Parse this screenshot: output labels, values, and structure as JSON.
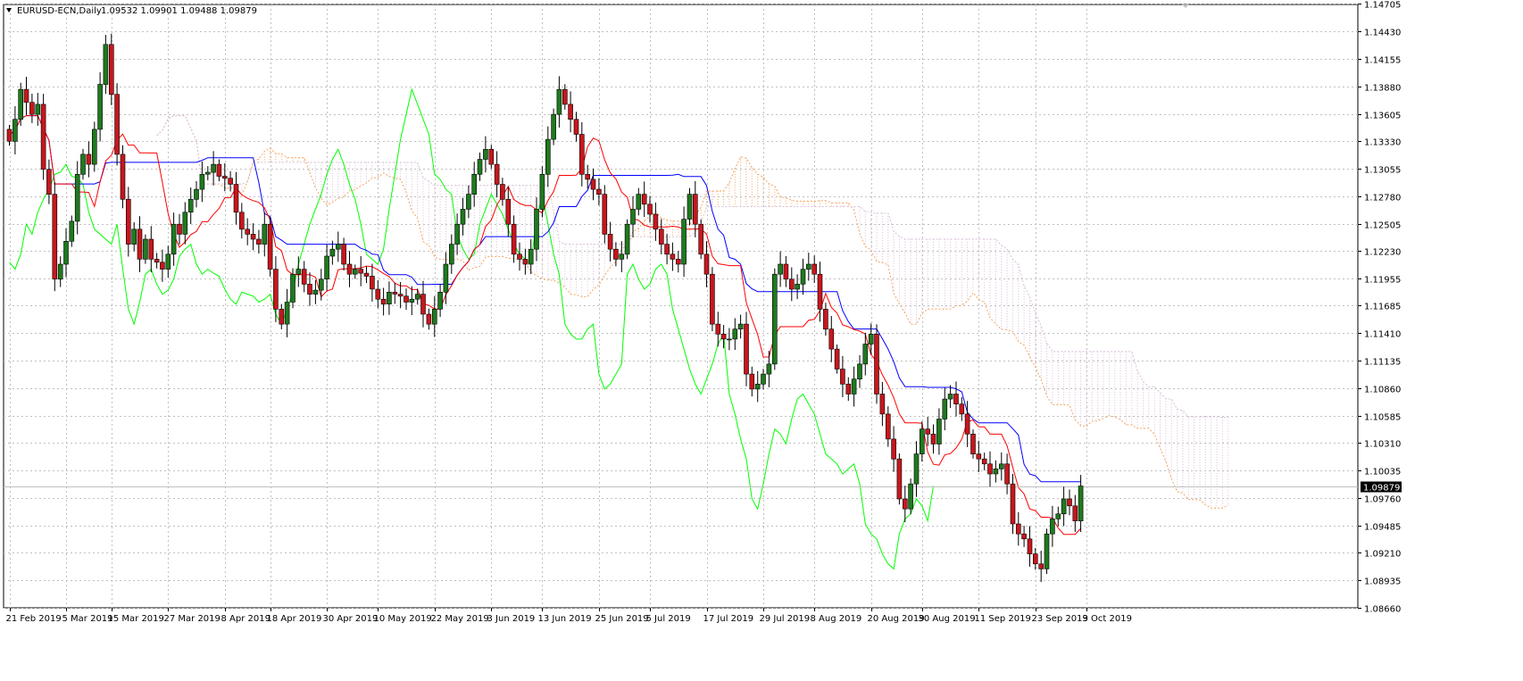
{
  "window": {
    "symbol_title": "EURUSD-ECN,Daily",
    "ohlc_text": "1.09532 1.09901 1.09488 1.09879"
  },
  "colors": {
    "background": "#ffffff",
    "grid": "#c0c0c0",
    "bull_candle": "#1e7a1e",
    "bear_candle": "#c8161d",
    "wick": "#000000",
    "tenkan": "#ff0000",
    "kijun": "#0000ff",
    "chikou": "#00ff00",
    "senkou_a": "#f4a460",
    "senkou_b": "#d8bfd8",
    "current_price_line": "#c0c0c0",
    "price_badge": "#000000"
  },
  "icons": {
    "title_marker": "triangle-down-icon",
    "shift_marker": "triangle-down-icon"
  },
  "chart_data": {
    "type": "candlestick",
    "title": "EURUSD-ECN,Daily",
    "y_range": [
      1.0866,
      1.147
    ],
    "y_ticks": [
      "1.14705",
      "1.14430",
      "1.14155",
      "1.13880",
      "1.13605",
      "1.13330",
      "1.13055",
      "1.12780",
      "1.12505",
      "1.12230",
      "1.11955",
      "1.11685",
      "1.11410",
      "1.11135",
      "1.10860",
      "1.10585",
      "1.10310",
      "1.10035",
      "1.09760",
      "1.09485",
      "1.09210",
      "1.08935",
      "1.08660"
    ],
    "x_ticks": [
      "21 Feb 2019",
      "5 Mar 2019",
      "15 Mar 2019",
      "27 Mar 2019",
      "8 Apr 2019",
      "18 Apr 2019",
      "30 Apr 2019",
      "10 May 2019",
      "22 May 2019",
      "3 Jun 2019",
      "13 Jun 2019",
      "25 Jun 2019",
      "5 Jul 2019",
      "17 Jul 2019",
      "29 Jul 2019",
      "8 Aug 2019",
      "20 Aug 2019",
      "30 Aug 2019",
      "11 Sep 2019",
      "23 Sep 2019",
      "3 Oct 2019"
    ],
    "x_tick_bar_index": [
      0,
      10,
      18,
      28,
      38,
      46,
      56,
      65,
      75,
      85,
      94,
      104,
      113,
      123,
      133,
      142,
      152,
      161,
      171,
      181,
      190
    ],
    "current_price": "1.09879",
    "close_series": [
      1.1333,
      1.1355,
      1.1385,
      1.1372,
      1.136,
      1.137,
      1.1305,
      1.128,
      1.1195,
      1.121,
      1.1233,
      1.1253,
      1.13,
      1.132,
      1.131,
      1.1345,
      1.139,
      1.143,
      1.138,
      1.132,
      1.1275,
      1.123,
      1.1245,
      1.1215,
      1.1235,
      1.1215,
      1.1212,
      1.1205,
      1.122,
      1.125,
      1.124,
      1.1262,
      1.1275,
      1.1285,
      1.13,
      1.1302,
      1.131,
      1.1298,
      1.1296,
      1.129,
      1.1262,
      1.1245,
      1.124,
      1.1235,
      1.123,
      1.125,
      1.1205,
      1.1165,
      1.115,
      1.1172,
      1.12,
      1.1205,
      1.119,
      1.118,
      1.1184,
      1.1195,
      1.1218,
      1.1225,
      1.123,
      1.121,
      1.12,
      1.1205,
      1.1201,
      1.1198,
      1.1185,
      1.1175,
      1.117,
      1.1182,
      1.118,
      1.1178,
      1.1172,
      1.1175,
      1.118,
      1.116,
      1.115,
      1.1165,
      1.1182,
      1.121,
      1.123,
      1.125,
      1.1265,
      1.128,
      1.13,
      1.1315,
      1.1325,
      1.131,
      1.129,
      1.1275,
      1.125,
      1.122,
      1.1215,
      1.121,
      1.1225,
      1.1265,
      1.13,
      1.1335,
      1.136,
      1.1385,
      1.137,
      1.1355,
      1.134,
      1.13,
      1.1295,
      1.1285,
      1.128,
      1.124,
      1.1225,
      1.1215,
      1.122,
      1.125,
      1.1265,
      1.128,
      1.127,
      1.126,
      1.1245,
      1.123,
      1.122,
      1.1215,
      1.121,
      1.1255,
      1.128,
      1.125,
      1.122,
      1.12,
      1.115,
      1.114,
      1.1135,
      1.1135,
      1.1145,
      1.115,
      1.11,
      1.1085,
      1.109,
      1.11,
      1.111,
      1.12,
      1.121,
      1.1195,
      1.1185,
      1.119,
      1.1205,
      1.121,
      1.12,
      1.1165,
      1.1145,
      1.1125,
      1.1105,
      1.109,
      1.108,
      1.1095,
      1.111,
      1.113,
      1.114,
      1.108,
      1.106,
      1.1035,
      1.1015,
      1.0975,
      1.0965,
      1.099,
      1.102,
      1.1045,
      1.104,
      1.103,
      1.1055,
      1.1075,
      1.108,
      1.107,
      1.106,
      1.104,
      1.102,
      1.1015,
      1.101,
      1.1,
      1.1005,
      1.101,
      1.099,
      1.095,
      1.094,
      1.0935,
      1.092,
      1.091,
      1.0905,
      1.094,
      1.0955,
      1.096,
      1.0975,
      1.0968,
      1.0953,
      1.0988
    ]
  }
}
